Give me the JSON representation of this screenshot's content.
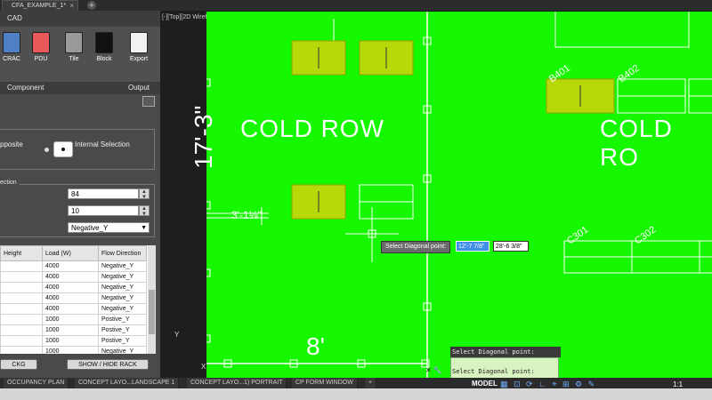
{
  "doc_tab": {
    "title": "CFA_EXAMPLE_1*",
    "close": "×",
    "add": "+"
  },
  "panel": {
    "header": "CAD",
    "tools": [
      {
        "label": "CRAC",
        "color": "#4f7fc4"
      },
      {
        "label": "PDU",
        "color": "#e85a5a"
      },
      {
        "label": "Tile",
        "color": "#9a9a9a"
      },
      {
        "label": "Block",
        "color": "#111111"
      },
      {
        "label": "Export",
        "color": "#f2f2f2"
      }
    ],
    "section_component": "Component",
    "section_output": "Output",
    "option_opposite": "pposite",
    "option_internal": "Internal Selection",
    "direction_group": "ection",
    "input_1": "84",
    "input_2": "10",
    "select_value": "Negative_Y",
    "table": {
      "headers": [
        "Height",
        "Load (W)",
        "Flow Direction"
      ],
      "rows": [
        [
          "",
          "4000",
          "Negative_Y"
        ],
        [
          "",
          "4000",
          "Negative_Y"
        ],
        [
          "",
          "4000",
          "Negative_Y"
        ],
        [
          "",
          "4000",
          "Negative_Y"
        ],
        [
          "",
          "4000",
          "Negative_Y"
        ],
        [
          "",
          "1000",
          "Postive_Y"
        ],
        [
          "",
          "1000",
          "Postive_Y"
        ],
        [
          "",
          "1000",
          "Postive_Y"
        ],
        [
          "",
          "1000",
          "Negative_Y"
        ],
        [
          "",
          "10",
          "Negative_Y"
        ]
      ]
    },
    "btn_left": "CKG",
    "btn_show_hide": "SHOW / HIDE RACK"
  },
  "viewport": {
    "label": "[-][Top][2D Wireframe]",
    "cold_row_1": "COLD ROW",
    "cold_row_2": "COLD RO",
    "dim_vertical": "17'-3\"",
    "dim_small": "3'-1⅛\"",
    "dim_bottom": "8'",
    "rack_labels": [
      "B401",
      "B402",
      "C301",
      "C302"
    ],
    "tooltip_label": "Select Diagonal point:",
    "tooltip_value_1": "12'-7 7/8\"",
    "tooltip_value_2": "28'-6 3/8\"",
    "ucs_y": "Y",
    "ucs_x": "X"
  },
  "command": {
    "history": "Select Diagonal point:",
    "prompt": "Select Diagonal point:",
    "icons": "✕ 🔧"
  },
  "layout_tabs": [
    "OCCUPANCY PLAN",
    "CONCEPT LAYO...LANDSCAPE 1",
    "CONCEPT LAYO...1) PORTRAIT",
    "CP FORM WINDOW",
    "+"
  ],
  "status": {
    "model": "MODEL",
    "zoom": "1:1",
    "icons": "▦ ⊡ ⟳ ∟ ⌖ ⊞ ⚙ ✎"
  },
  "colors": {
    "canvas": "#16f800",
    "rack_fill": "#b7d90a",
    "accent": "#3f8fe8"
  }
}
